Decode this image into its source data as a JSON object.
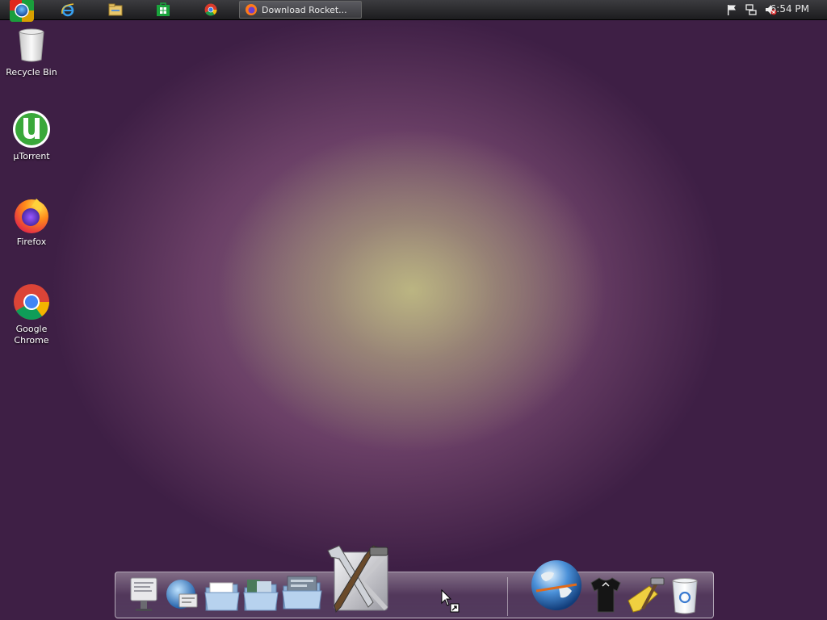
{
  "taskbar": {
    "pinned": [
      {
        "name": "internet-explorer-icon"
      },
      {
        "name": "file-explorer-icon"
      },
      {
        "name": "windows-store-icon"
      },
      {
        "name": "chrome-icon"
      }
    ],
    "active_window": {
      "title": "Download Rocket...",
      "icon": "firefox-icon"
    },
    "clock": "6:54 PM",
    "tray_icons": [
      "flag-icon",
      "network-icon",
      "volume-muted-icon"
    ]
  },
  "desktop": {
    "icons": [
      {
        "label": "Recycle Bin",
        "icon": "recycle-bin-icon"
      },
      {
        "label": "µTorrent",
        "icon": "utorrent-icon"
      },
      {
        "label": "Firefox",
        "icon": "firefox-icon"
      },
      {
        "label": "Google Chrome",
        "icon": "chrome-icon"
      }
    ]
  },
  "dock": {
    "items": [
      "system-preferences-icon",
      "network-icon",
      "documents-folder-icon",
      "applications-folder-icon",
      "downloads-folder-icon",
      "utilities-tools-icon",
      "globe-icon",
      "tshirt-icon",
      "hammer-tools-icon",
      "trash-icon"
    ]
  },
  "colors": {
    "taskbar": "#2a2a2e",
    "accent": "#e8e8e8"
  }
}
